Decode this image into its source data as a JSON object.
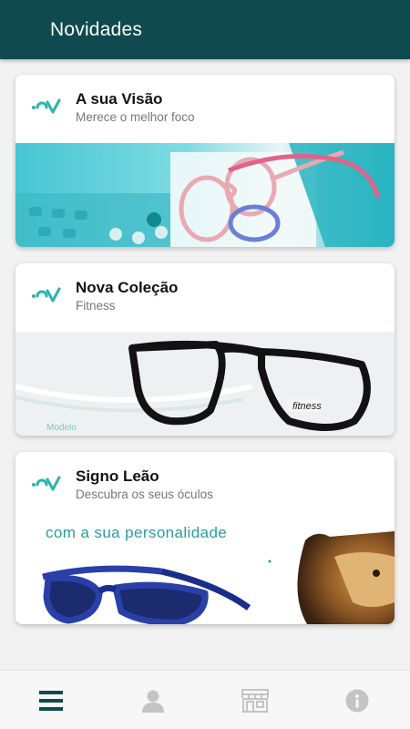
{
  "header": {
    "title": "Novidades"
  },
  "colors": {
    "appbar": "#0f4a4e",
    "accent": "#2bb3b1",
    "nav_active": "#0f4a4e",
    "nav_inactive": "#bdbdbd"
  },
  "cards": [
    {
      "logo": "brand-logo-icon",
      "title": "A sua Visão",
      "subtitle": "Merece o melhor foco",
      "image": "pink-eyeglasses-photo"
    },
    {
      "logo": "brand-logo-icon",
      "title": "Nova Coleção",
      "subtitle": "Fitness",
      "image": "black-eyeglasses-photo",
      "caption": "Modelo",
      "frame_text": "fitness"
    },
    {
      "logo": "brand-logo-icon",
      "title": "Signo Leão",
      "subtitle": "Descubra os seus óculos",
      "image": "lion-and-blue-sunglasses-photo",
      "promo": "com a sua personalidade"
    }
  ],
  "bottom_nav": [
    {
      "icon": "menu-icon",
      "active": true
    },
    {
      "icon": "user-icon",
      "active": false
    },
    {
      "icon": "store-icon",
      "active": false
    },
    {
      "icon": "info-icon",
      "active": false
    }
  ]
}
